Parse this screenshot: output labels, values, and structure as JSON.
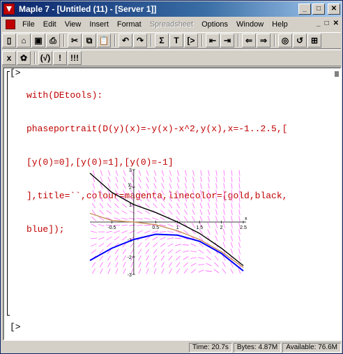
{
  "window": {
    "title": "Maple 7 - [Untitled (11) - [Server 1]]"
  },
  "title_buttons": {
    "minimize": "_",
    "maximize": "□",
    "close": "✕"
  },
  "menu": {
    "items": [
      "File",
      "Edit",
      "View",
      "Insert",
      "Format",
      "Spreadsheet",
      "Options",
      "Window",
      "Help"
    ],
    "disabled": [
      "Spreadsheet"
    ],
    "right_controls": [
      "_",
      "□",
      "✕"
    ]
  },
  "toolbar1": {
    "tools": [
      {
        "name": "new-icon",
        "glyph": "▯"
      },
      {
        "name": "open-icon",
        "glyph": "⌂"
      },
      {
        "name": "save-icon",
        "glyph": "▣"
      },
      {
        "name": "print-icon",
        "glyph": "⎙"
      },
      {
        "name": "cut-icon",
        "glyph": "✂"
      },
      {
        "name": "copy-icon",
        "glyph": "⧉"
      },
      {
        "name": "paste-icon",
        "glyph": "📋"
      },
      {
        "name": "undo-icon",
        "glyph": "↶"
      },
      {
        "name": "redo-icon",
        "glyph": "↷"
      },
      {
        "name": "sigma-icon",
        "glyph": "Σ"
      },
      {
        "name": "text-icon",
        "glyph": "T"
      },
      {
        "name": "prompt-icon",
        "glyph": "[>"
      },
      {
        "name": "outdent-icon",
        "glyph": "⇤"
      },
      {
        "name": "indent-icon",
        "glyph": "⇥"
      },
      {
        "name": "back-icon",
        "glyph": "⇐"
      },
      {
        "name": "forward-icon",
        "glyph": "⇒"
      },
      {
        "name": "stop-icon",
        "glyph": "◎"
      },
      {
        "name": "restart-icon",
        "glyph": "↺"
      },
      {
        "name": "zoom-icon",
        "glyph": "⊞"
      }
    ]
  },
  "toolbar2": {
    "tools": [
      {
        "name": "math-mode-icon",
        "glyph": "x"
      },
      {
        "name": "maple-leaf-icon",
        "glyph": "✿"
      },
      {
        "name": "eval-icon",
        "glyph": "(√)"
      },
      {
        "name": "exec-icon",
        "glyph": "!"
      },
      {
        "name": "exec-all-icon",
        "glyph": "!!!"
      }
    ]
  },
  "worksheet": {
    "prompt1": "[>",
    "code_lines": [
      "with(DEtools):",
      "phaseportrait(D(y)(x)=-y(x)-x^2,y(x),x=-1..2.5,[",
      "[y(0)=0],[y(0)=1],[y(0)=-1]",
      "],title=``,colour=magenta,linecolor=[gold,black,",
      "blue]);"
    ],
    "prompt2": "[>"
  },
  "chart_data": {
    "type": "line",
    "title": "",
    "xlabel": "x",
    "ylabel": "y",
    "xlim": [
      -1,
      2.5
    ],
    "ylim": [
      -3,
      3
    ],
    "x_ticks": [
      -0.5,
      0.5,
      1,
      1.5,
      2,
      2.5
    ],
    "y_ticks": [
      -3,
      -2,
      -1,
      1,
      2,
      3
    ],
    "field_color": "#ff66ff",
    "series": [
      {
        "color": "#c8905a",
        "x": [
          -1,
          -0.5,
          0,
          0.5,
          1,
          1.5,
          2,
          2.5
        ],
        "y": [
          0.5,
          0.09,
          0,
          -0.15,
          -0.5,
          -1.0,
          -1.7,
          -2.6
        ]
      },
      {
        "color": "#000000",
        "x": [
          -1,
          -0.5,
          0,
          0.5,
          1,
          1.5,
          2,
          2.5
        ],
        "y": [
          2.8,
          1.7,
          1.0,
          0.55,
          0.0,
          -0.65,
          -1.5,
          -2.5
        ]
      },
      {
        "color": "#0000ff",
        "x": [
          -1,
          -0.5,
          0,
          0.5,
          1,
          1.5,
          2,
          2.5
        ],
        "y": [
          -2.2,
          -1.5,
          -1.0,
          -0.7,
          -0.75,
          -1.1,
          -1.8,
          -2.8
        ]
      }
    ]
  },
  "status": {
    "time": "Time: 20.7s",
    "bytes": "Bytes: 4.87M",
    "available": "Available: 76.6M"
  }
}
